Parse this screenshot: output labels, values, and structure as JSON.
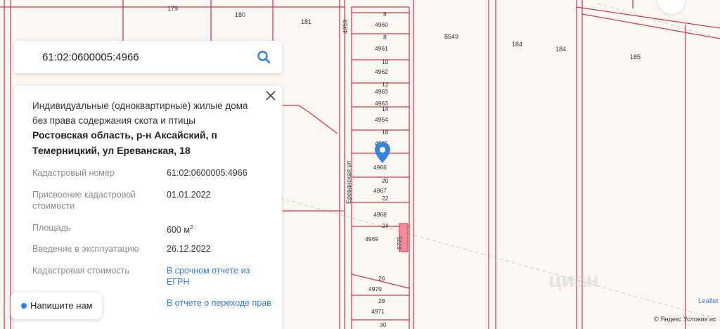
{
  "search": {
    "query": "61:02:0600005:4966"
  },
  "card": {
    "use_description": "Индивидуальные (одноквартирные) жилые дома без права содержания скота и птицы",
    "address": "Ростовская область, р-н Аксайский, п Темерницкий, ул Ереванская, 18",
    "rows": [
      {
        "label": "Кадастровый номер",
        "value": "61:02:0600005:4966"
      },
      {
        "label": "Присвоение кадастровой стоимости",
        "value": "01.01.2022"
      },
      {
        "label": "Площадь",
        "value": "600 м",
        "unit_sup": "2"
      },
      {
        "label": "Введение в эксплуатацию",
        "value": "26.12.2022"
      },
      {
        "label": "Кадастровая стоимость",
        "value": "В срочном отчете из ЕГРН"
      },
      {
        "label": "",
        "value": "В отчете о переходе прав"
      }
    ]
  },
  "chat": {
    "label": "Напишите нам"
  },
  "map": {
    "street_label": "Ереванская ул",
    "parcel_labels": [
      "179",
      "180",
      "181",
      "4959",
      "8549",
      "184",
      "184",
      "185",
      "4960",
      "4961",
      "4962",
      "4963",
      "4963",
      "4964",
      "4965",
      "4966",
      "4967",
      "4968",
      "4969",
      "4970",
      "4971",
      "8725"
    ],
    "house_numbers": [
      "8",
      "8",
      "10",
      "12",
      "14",
      "16",
      "20",
      "22",
      "24",
      "26",
      "28",
      "30"
    ],
    "marker_color": "#3b82d6",
    "line_color": "#d6304a"
  },
  "attribution": {
    "leaflet": "Leaflet",
    "yandex": "© Яндекс Условия ис",
    "watermark": "циан"
  }
}
